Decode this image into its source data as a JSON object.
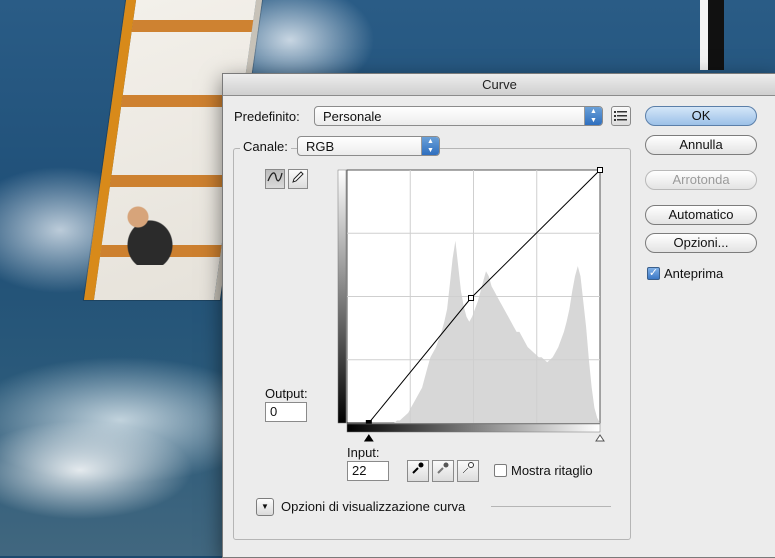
{
  "dialog": {
    "title": "Curve"
  },
  "preset": {
    "label": "Predefinito:",
    "value": "Personale"
  },
  "channel": {
    "label": "Canale:",
    "value": "RGB"
  },
  "buttons": {
    "ok": "OK",
    "cancel": "Annulla",
    "smooth": "Arrotonda",
    "auto": "Automatico",
    "options": "Opzioni..."
  },
  "preview": {
    "label": "Anteprima",
    "checked": true
  },
  "output": {
    "label": "Output:",
    "value": "0"
  },
  "input": {
    "label": "Input:",
    "value": "22"
  },
  "show_clipping": {
    "label": "Mostra ritaglio",
    "checked": false
  },
  "display_options": {
    "label": "Opzioni di visualizzazione curva"
  },
  "curve": {
    "points": [
      [
        22,
        0
      ],
      [
        125,
        126
      ],
      [
        255,
        255
      ]
    ],
    "line_color": "#000000",
    "histogram_color": "#d7d7d7"
  },
  "histogram": [
    0,
    0,
    0,
    0,
    0,
    0,
    0,
    0,
    0,
    0,
    0,
    0,
    0,
    0,
    0,
    0,
    0,
    0,
    1,
    1,
    2,
    3,
    4,
    6,
    8,
    10,
    12,
    14,
    18,
    22,
    26,
    28,
    30,
    33,
    36,
    40,
    45,
    55,
    65,
    72,
    62,
    52,
    46,
    42,
    40,
    42,
    45,
    48,
    52,
    56,
    60,
    58,
    54,
    52,
    50,
    48,
    46,
    44,
    42,
    40,
    38,
    36,
    36,
    34,
    32,
    30,
    29,
    28,
    27,
    26,
    26,
    25,
    24,
    25,
    26,
    28,
    30,
    33,
    36,
    40,
    45,
    52,
    58,
    62,
    58,
    48,
    38,
    25,
    14,
    6,
    2,
    0
  ]
}
